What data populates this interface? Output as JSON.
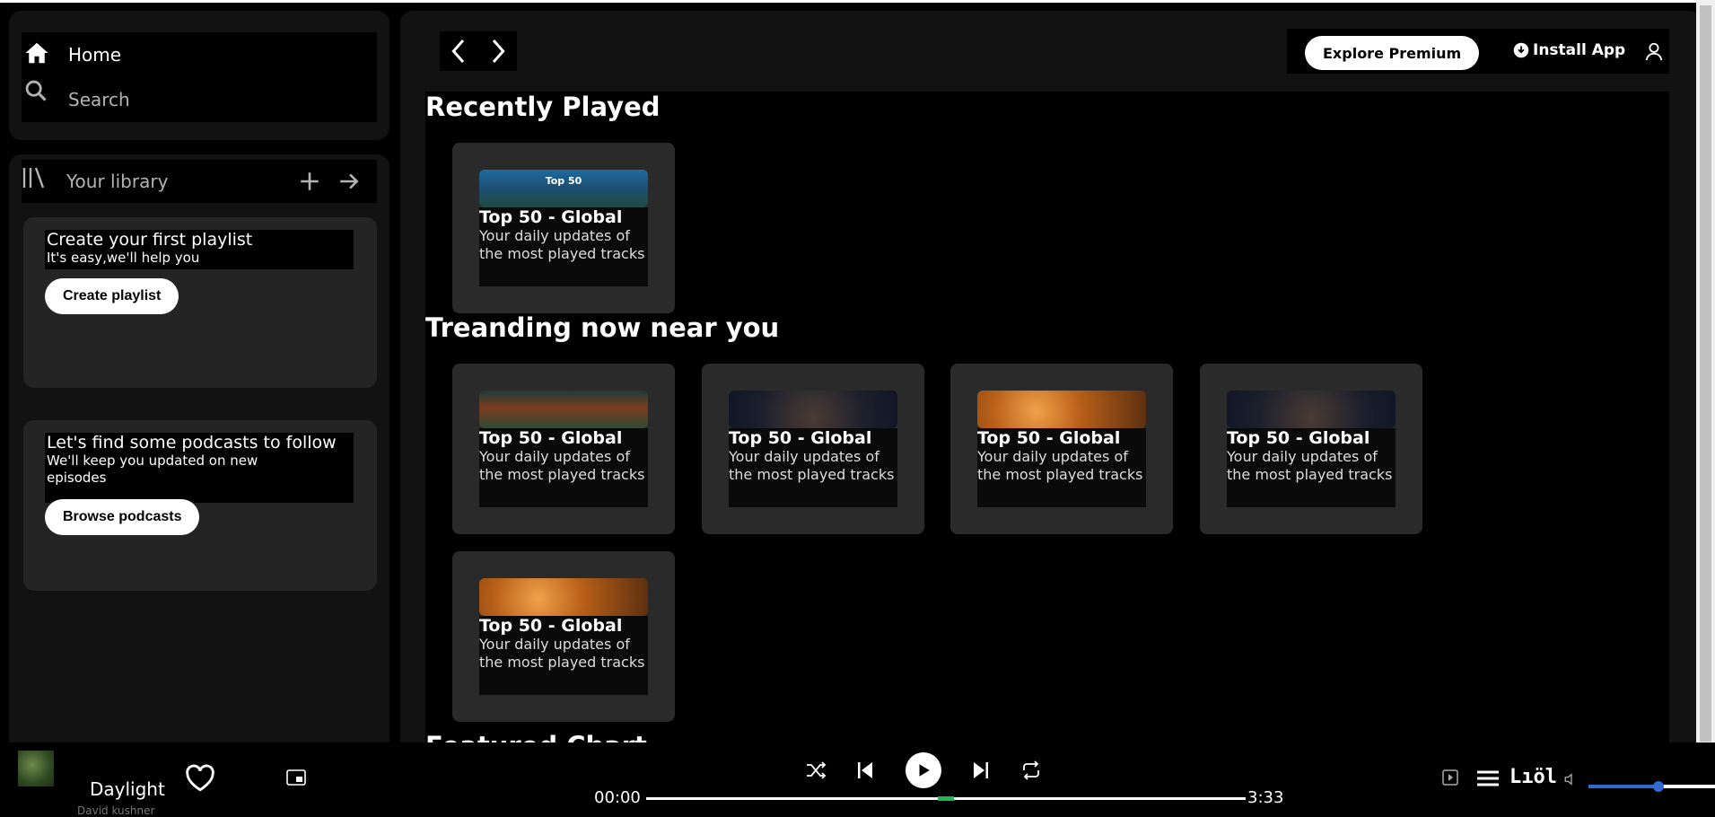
{
  "nav": {
    "home_label": "Home",
    "search_label": "Search"
  },
  "library": {
    "title": "Your library",
    "playlist_card": {
      "title": "Create your first playlist",
      "subtitle": "It's easy,we'll help you",
      "button": "Create playlist"
    },
    "podcast_card": {
      "title": "Let's find some podcasts to follow",
      "subtitle": "We'll keep you updated on new episodes",
      "button": "Browse podcasts"
    }
  },
  "header": {
    "explore_button": "Explore Premium",
    "install_button": "Install App"
  },
  "sections": [
    {
      "title": "Recently Played",
      "tiles": [
        {
          "name": "Top 50 - Global",
          "desc": "Your daily updates of the most played tracks",
          "cover_text": "Top 50"
        }
      ]
    },
    {
      "title": "Treanding now near you",
      "tiles": [
        {
          "name": "Top 50 - Global",
          "desc": "Your daily updates of the most played tracks"
        },
        {
          "name": "Top 50 - Global",
          "desc": "Your daily updates of the most played tracks"
        },
        {
          "name": "Top 50 - Global",
          "desc": "Your daily updates of the most played tracks"
        },
        {
          "name": "Top 50 - Global",
          "desc": "Your daily updates of the most played tracks"
        },
        {
          "name": "Top 50 - Global",
          "desc": "Your daily updates of the most played tracks"
        }
      ]
    },
    {
      "title": "Featured Chart"
    }
  ],
  "player": {
    "song": "Daylight",
    "artist": "David kushner",
    "time_current": "00:00",
    "time_total": "3:33",
    "progress": 0.5,
    "volume": 0.55,
    "lyrics_label": "Lıöl"
  }
}
